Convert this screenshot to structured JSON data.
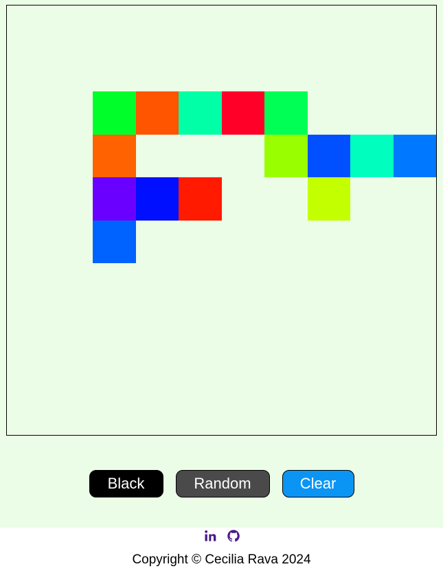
{
  "buttons": {
    "black": "Black",
    "random": "Random",
    "clear": "Clear"
  },
  "colors": {
    "background": "#ebfde6",
    "black_button": "#000000",
    "random_button": "#4a4a4a",
    "clear_button": "#0a95f5",
    "icon_color": "#4b1a8c"
  },
  "grid": {
    "columns": 10,
    "rows": 10,
    "cells": [
      {
        "row": 2,
        "col": 2,
        "color": "#00ff2a"
      },
      {
        "row": 2,
        "col": 3,
        "color": "#ff5500"
      },
      {
        "row": 2,
        "col": 4,
        "color": "#00ffa6"
      },
      {
        "row": 2,
        "col": 5,
        "color": "#ff0029"
      },
      {
        "row": 2,
        "col": 6,
        "color": "#00ff55"
      },
      {
        "row": 3,
        "col": 2,
        "color": "#ff6200"
      },
      {
        "row": 3,
        "col": 6,
        "color": "#99ff00"
      },
      {
        "row": 3,
        "col": 7,
        "color": "#0050ff"
      },
      {
        "row": 3,
        "col": 8,
        "color": "#00ffbf"
      },
      {
        "row": 3,
        "col": 9,
        "color": "#0078ff"
      },
      {
        "row": 4,
        "col": 2,
        "color": "#6a00ff"
      },
      {
        "row": 4,
        "col": 3,
        "color": "#000fff"
      },
      {
        "row": 4,
        "col": 4,
        "color": "#ff1a00"
      },
      {
        "row": 4,
        "col": 7,
        "color": "#c4ff00"
      },
      {
        "row": 5,
        "col": 2,
        "color": "#0062ff"
      }
    ]
  },
  "footer": {
    "icons": [
      "linkedin-icon",
      "github-icon"
    ],
    "copyright": "Copyright © Cecilia Rava 2024"
  }
}
